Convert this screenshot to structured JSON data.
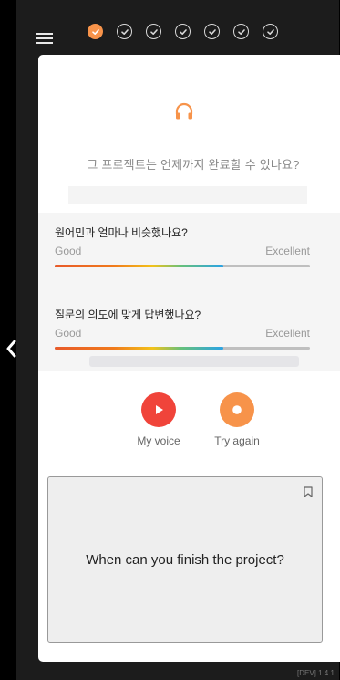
{
  "header": {
    "progress": [
      {
        "state": "active"
      },
      {
        "state": "done"
      },
      {
        "state": "done"
      },
      {
        "state": "done"
      },
      {
        "state": "done"
      },
      {
        "state": "done"
      },
      {
        "state": "done"
      }
    ]
  },
  "card": {
    "question": "그 프로젝트는 언제까지 완료할 수 있나요?",
    "ratings": [
      {
        "title": "원어민과 얼마나 비슷했나요?",
        "min_label": "Good",
        "max_label": "Excellent",
        "level": 0.66
      },
      {
        "title": "질문의 의도에 맞게 답변했나요?",
        "min_label": "Good",
        "max_label": "Excellent",
        "level": 0.66
      }
    ],
    "controls": {
      "my_voice_label": "My voice",
      "try_again_label": "Try again"
    },
    "answer": {
      "text": "When can you finish the project?"
    }
  },
  "version": "[DEV] 1.4.1",
  "colors": {
    "accent_orange": "#f7934a",
    "play_red": "#f0443a",
    "background": "#1c1c1c"
  },
  "icons": [
    "menu-icon",
    "headphone-icon",
    "play-icon",
    "record-icon",
    "bookmark-icon",
    "chevron-left-icon",
    "chevron-right-icon"
  ]
}
